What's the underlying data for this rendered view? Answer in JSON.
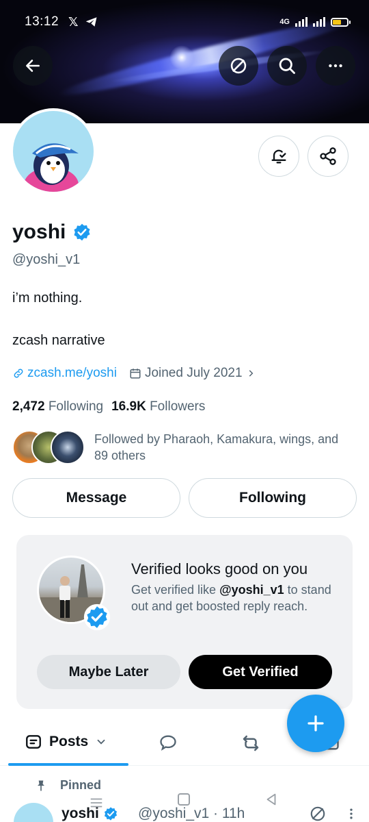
{
  "status_bar": {
    "time": "13:12",
    "network": "4G"
  },
  "profile": {
    "name": "yoshi",
    "handle": "@yoshi_v1",
    "bio_line1": "i’m nothing.",
    "bio_line2": "zcash narrative",
    "link": "zcash.me/yoshi",
    "joined": "Joined July 2021",
    "following_count": "2,472",
    "following_label": "Following",
    "followers_count": "16.9K",
    "followers_label": "Followers",
    "followed_by": "Followed by Pharaoh, Kamakura, wings, and 89 others"
  },
  "actions": {
    "message": "Message",
    "following": "Following"
  },
  "verified_card": {
    "title": "Verified looks good on you",
    "text_pre": "Get verified like ",
    "text_handle": "@yoshi_v1",
    "text_post": " to stand out and get boosted reply reach.",
    "maybe_later": "Maybe Later",
    "get_verified": "Get Verified"
  },
  "tabs": {
    "posts": "Posts"
  },
  "pinned": {
    "label": "Pinned"
  },
  "post": {
    "name": "yoshi",
    "handle_time": "@yoshi_v1 · 11h"
  },
  "icons": {
    "back": "arrow-left-icon",
    "zcash": "zcash-icon",
    "search": "search-icon",
    "more": "more-horizontal-icon",
    "bell": "bell-check-icon",
    "share": "share-icon",
    "link": "link-icon",
    "calendar": "calendar-icon",
    "verified": "verified-badge-icon",
    "compose": "plus-icon"
  },
  "colors": {
    "accent": "#1d9bf0",
    "text": "#0f1419",
    "muted": "#536471"
  }
}
